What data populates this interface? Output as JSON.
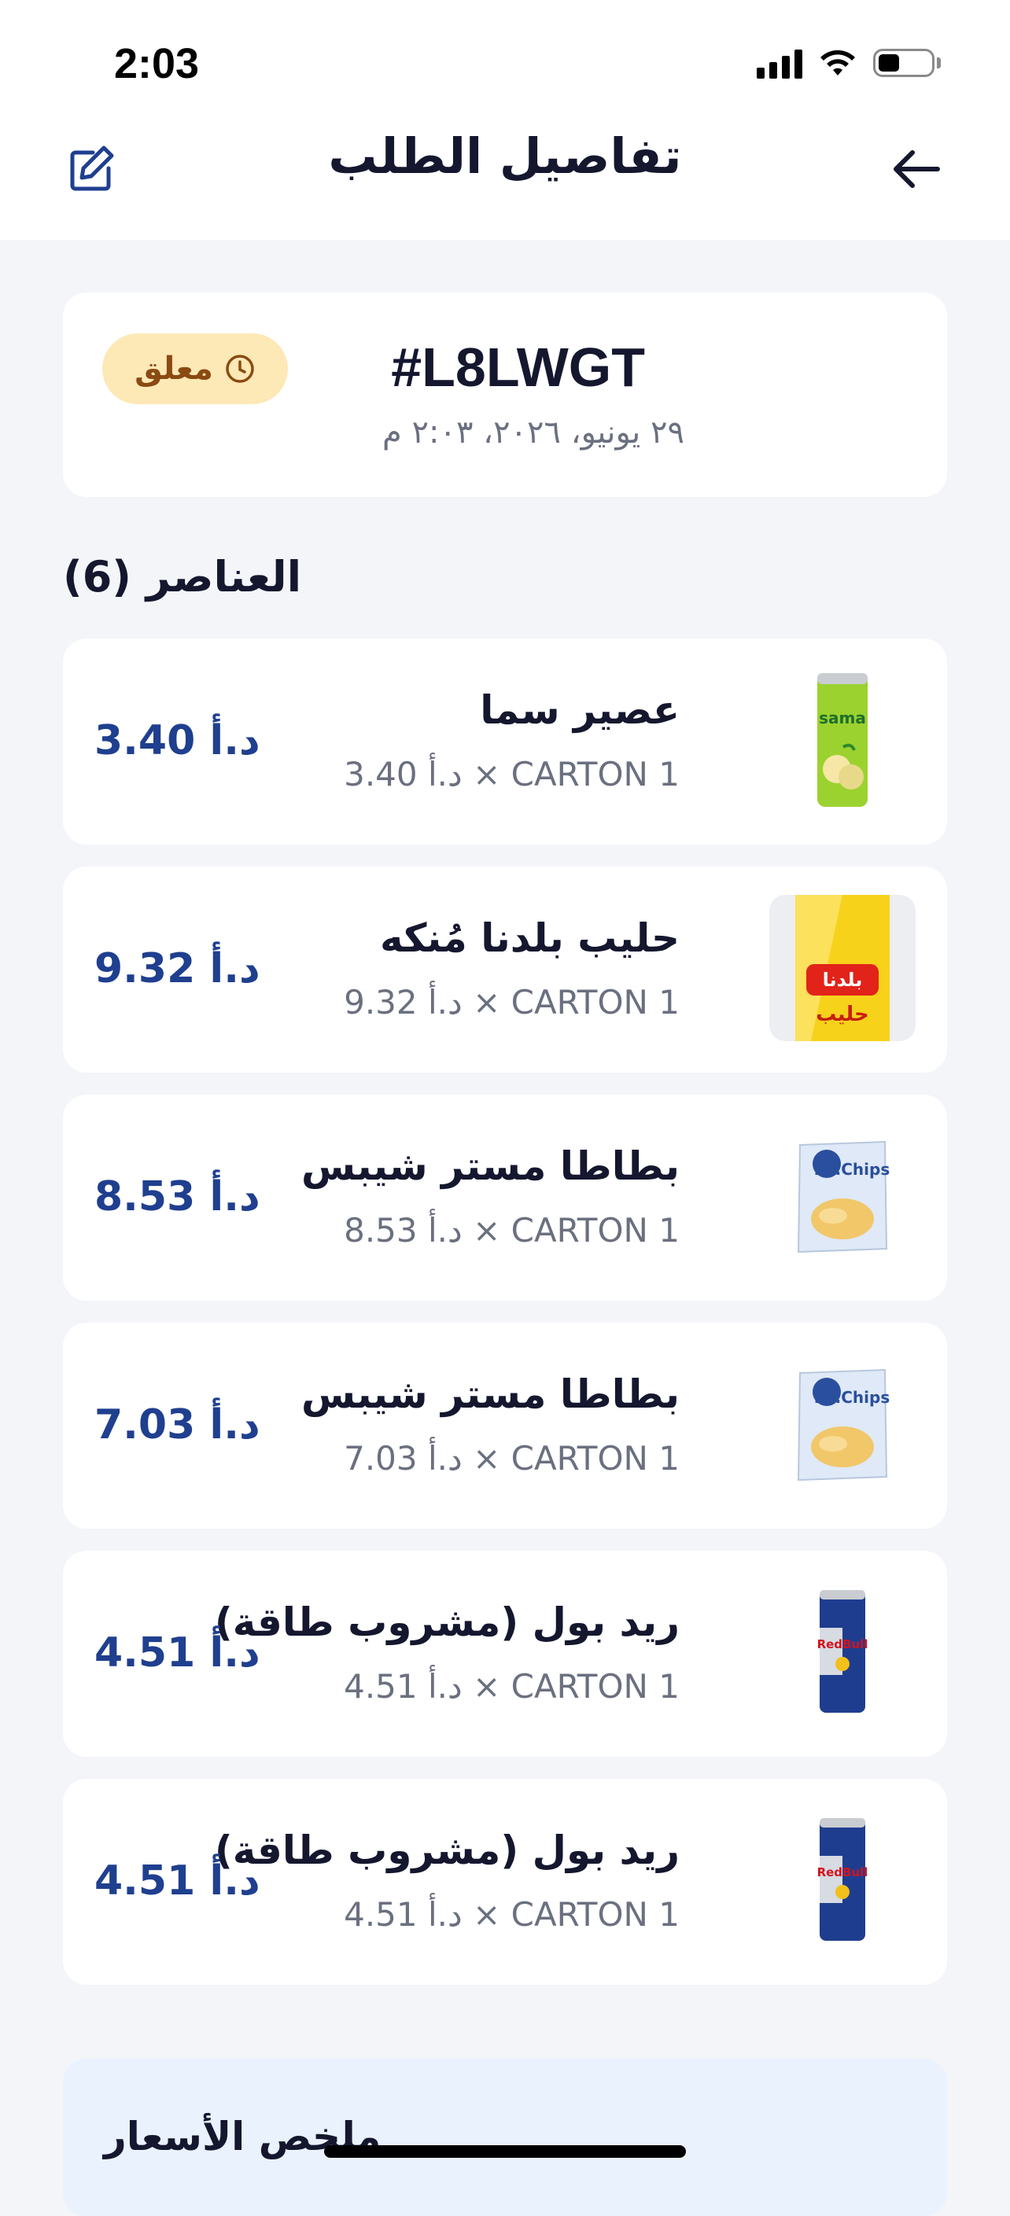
{
  "status_bar": {
    "time": "2:03",
    "battery_level": 0.4
  },
  "header": {
    "title": "تفاصيل الطلب"
  },
  "order": {
    "id": "#L8LWGT",
    "date": "٢٩ يونيو، ٢٠٢٦، ٢:٠٣ م",
    "status": "معلق",
    "status_bg": "#fde9b6",
    "status_color": "#8a4a12"
  },
  "items_section": {
    "title": "العناصر (6)"
  },
  "items": [
    {
      "name": "عصير سما",
      "meta": "3.40 د.أ × CARTON 1",
      "price": "3.40 د.أ",
      "image": "sama-juice-can"
    },
    {
      "name": "حليب بلدنا مُنكه",
      "meta": "9.32 د.أ × CARTON 1",
      "price": "9.32 د.أ",
      "image": "baladna-milk-pack"
    },
    {
      "name": "بطاطا مستر شيبس",
      "meta": "8.53 د.أ × CARTON 1",
      "price": "8.53 د.أ",
      "image": "mr-chips-bag"
    },
    {
      "name": "بطاطا مستر شيبس",
      "meta": "7.03 د.أ × CARTON 1",
      "price": "7.03 د.أ",
      "image": "mr-chips-bag"
    },
    {
      "name": "ريد بول (مشروب طاقة)",
      "meta": "4.51 د.أ × CARTON 1",
      "price": "4.51 د.أ",
      "image": "red-bull-can"
    },
    {
      "name": "ريد بول (مشروب طاقة)",
      "meta": "4.51 د.أ × CARTON 1",
      "price": "4.51 د.أ",
      "image": "red-bull-can"
    }
  ],
  "summary": {
    "title": "ملخص الأسعار"
  },
  "colors": {
    "accent_price": "#1f3f8f",
    "background": "#f3f5f9"
  }
}
